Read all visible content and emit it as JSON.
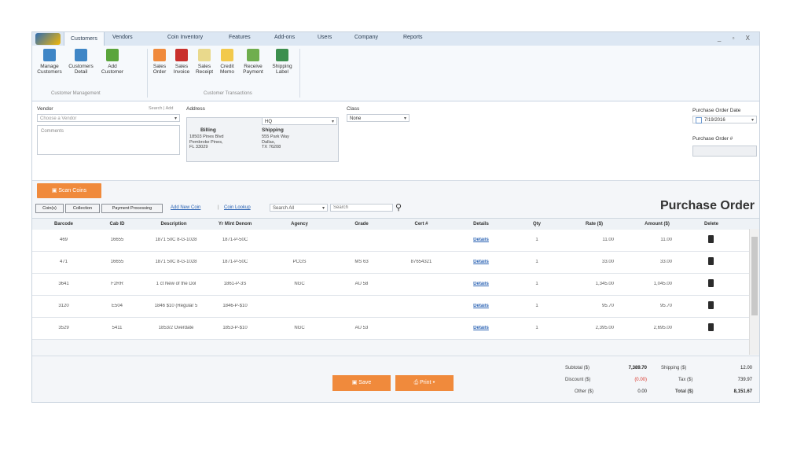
{
  "menu": {
    "tabs": [
      "Customers",
      "Vendors",
      "Coin Inventory",
      "Features",
      "Add-ons",
      "Users",
      "Company",
      "Reports"
    ],
    "window_controls": "_ ▫ X"
  },
  "ribbon": {
    "buttons": [
      {
        "label": "Manage Customers",
        "icon": "manage-customers-icon",
        "color": "#3f86c6"
      },
      {
        "label": "Customers Detail",
        "icon": "customers-detail-icon",
        "color": "#3f86c6"
      },
      {
        "label": "Add Customer",
        "icon": "add-customer-icon",
        "color": "#5aa53c"
      },
      {
        "label": "Sales Order",
        "icon": "sales-order-icon",
        "color": "#f08a3c"
      },
      {
        "label": "Sales Invoice",
        "icon": "sales-invoice-icon",
        "color": "#c9302c"
      },
      {
        "label": "Sales Receipt",
        "icon": "sales-receipt-icon",
        "color": "#e9d98c"
      },
      {
        "label": "Credit Memo",
        "icon": "credit-memo-icon",
        "color": "#f2c94c"
      },
      {
        "label": "Receive Payment",
        "icon": "receive-payment-icon",
        "color": "#6fae4e"
      },
      {
        "label": "Shipping Label",
        "icon": "shipping-label-icon",
        "color": "#3c8f4e"
      }
    ],
    "groups": [
      "Customer Management",
      "Customer Transactions"
    ]
  },
  "form": {
    "vendor_label": "Vendor",
    "search_add": "Search | Add",
    "vendor_placeholder": "Choose a Vendor",
    "comments_placeholder": "Comments",
    "address_label": "Address",
    "address_select": "HQ",
    "billing_label": "Billing",
    "billing_lines": "18503 Pines Blvd\nPembroke Pines,\nFL 33029",
    "shipping_label": "Shipping",
    "shipping_lines": "555 Park Way\nDallas,\nTX 76208",
    "class_label": "Class",
    "class_value": "None",
    "po_date_label": "Purchase Order Date",
    "po_date_value": "7/19/2016",
    "po_number_label": "Purchase Order #"
  },
  "toolbar": {
    "scan_label": "Scan Coins",
    "pills": [
      "Coin(s)",
      "Collection",
      "Payment Processing"
    ],
    "add_new_coin": "Add New Coin",
    "coin_lookup": "Coin Lookup",
    "search_scope": "Search All",
    "search_placeholder": "Search"
  },
  "page_title": "Purchase Order",
  "table": {
    "headers": [
      "Barcode",
      "Cab ID",
      "Description",
      "Yr Mint Denom",
      "Agency",
      "Grade",
      "Cert #",
      "Details",
      "Qty",
      "Rate ($)",
      "Amount ($)",
      "Delete"
    ],
    "rows": [
      [
        "469",
        "16655",
        "1871 50C 8-G-1028",
        "1871-P-50C",
        "",
        "",
        "",
        "Details",
        "1",
        "11.00",
        "11.00"
      ],
      [
        "471",
        "16655",
        "1871 50C 8-G-1028",
        "1871-P-50C",
        "PCGS",
        "MS 63",
        "87654321",
        "Details",
        "1",
        "33.00",
        "33.00"
      ],
      [
        "3641",
        "F2RR",
        "1 ct New of the Dol",
        "1861-P-3S",
        "NGC",
        "AU 58",
        "",
        "Details",
        "1",
        "1,345.00",
        "1,045.00"
      ],
      [
        "3120",
        "E504",
        "1846 $10 (Regular 5",
        "1846-P-$10",
        "",
        "",
        "",
        "Details",
        "1",
        "95.70",
        "95.70"
      ],
      [
        "3529",
        "5411",
        "1853/2 Overdate",
        "1853-P-$10",
        "NGC",
        "AU 53",
        "",
        "Details",
        "1",
        "2,395.00",
        "2,695.00"
      ]
    ]
  },
  "footer": {
    "save_label": "Save",
    "print_label": "Print",
    "subtotal_label": "Subtotal ($)",
    "subtotal": "7,389.70",
    "discount_label": "Discount ($)",
    "discount": "(0.00)",
    "other_label": "Other ($)",
    "other": "0.00",
    "shipping_label": "Shipping ($)",
    "shipping": "12.00",
    "tax_label": "Tax ($)",
    "tax": "739.97",
    "total_label": "Total ($)",
    "total": "8,151.67"
  },
  "colors": {
    "accent": "#f08a3c",
    "link": "#2a62b3",
    "ribbon": "#f6f9fc"
  }
}
